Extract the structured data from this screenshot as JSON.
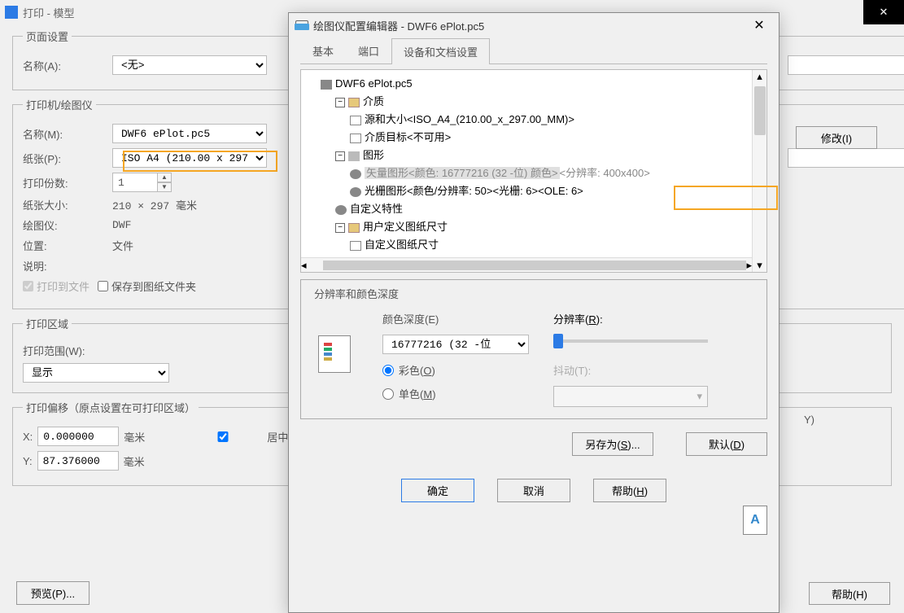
{
  "print_window": {
    "title": "打印 - 模型",
    "page_setup": {
      "legend": "页面设置",
      "name_label": "名称(A):",
      "name_value": "<无>"
    },
    "printer": {
      "legend": "打印机/绘图仪",
      "name_label": "名称(M):",
      "name_value": "DWF6 ePlot.pc5",
      "paper_label": "纸张(P):",
      "paper_value": "ISO A4 (210.00 x 297.",
      "copies_label": "打印份数:",
      "copies_value": "1",
      "size_label": "纸张大小:",
      "size_value": "210 × 297  毫米",
      "plotter_label": "绘图仪:",
      "plotter_value": "DWF",
      "location_label": "位置:",
      "location_value": "文件",
      "desc_label": "说明:",
      "print_to_file": "打印到文件",
      "save_to_sheet": "保存到图纸文件夹",
      "modify_btn": "修改(I)"
    },
    "area": {
      "legend": "打印区域",
      "range_label": "打印范围(W):",
      "range_value": "显示"
    },
    "offset": {
      "legend": "打印偏移（原点设置在可打印区域）",
      "x_label": "X:",
      "x_value": "0.000000",
      "unit": "毫米",
      "y_label": "Y:",
      "y_value": "87.376000",
      "center": "居中打印"
    },
    "preview_btn": "预览(P)...",
    "help_btn": "帮助(H)",
    "y_outer": "Y)"
  },
  "editor": {
    "title": "绘图仪配置编辑器 - DWF6 ePlot.pc5",
    "tabs": {
      "basic": "基本",
      "port": "端口",
      "device": "设备和文档设置"
    },
    "tree": {
      "root": "DWF6 ePlot.pc5",
      "media": "介质",
      "source": "源和大小<ISO_A4_(210.00_x_297.00_MM)>",
      "target": "介质目标<不可用>",
      "graphics": "图形",
      "vector_a": "矢量图形<颜色: 16777216 (32 -位) 颜色>",
      "vector_b": "<分辨率: 400x400>",
      "raster": "光栅图形<颜色/分辨率: 50><光栅: 6><OLE: 6>",
      "custom": "自定义特性",
      "userpaper": "用户定义图纸尺寸",
      "custompaper": "自定义图纸尺寸"
    },
    "group": {
      "title": "分辨率和颜色深度",
      "color_label": "颜色深度(E)",
      "color_value": "16777216 (32 -位",
      "radio_color": "彩色(",
      "radio_color_u": "O",
      "radio_color_end": ")",
      "radio_mono": "单色(",
      "radio_mono_u": "M",
      "radio_mono_end": ")",
      "res_label": "分辨率(",
      "res_u": "R",
      "res_end": "):",
      "dither_label": "抖动(T):"
    },
    "saveas": "另存为(",
    "saveas_u": "S",
    "saveas_end": ")...",
    "default": "默认(",
    "default_u": "D",
    "default_end": ")",
    "ok": "确定",
    "cancel": "取消",
    "help": "帮助(",
    "help_u": "H",
    "help_end": ")"
  }
}
